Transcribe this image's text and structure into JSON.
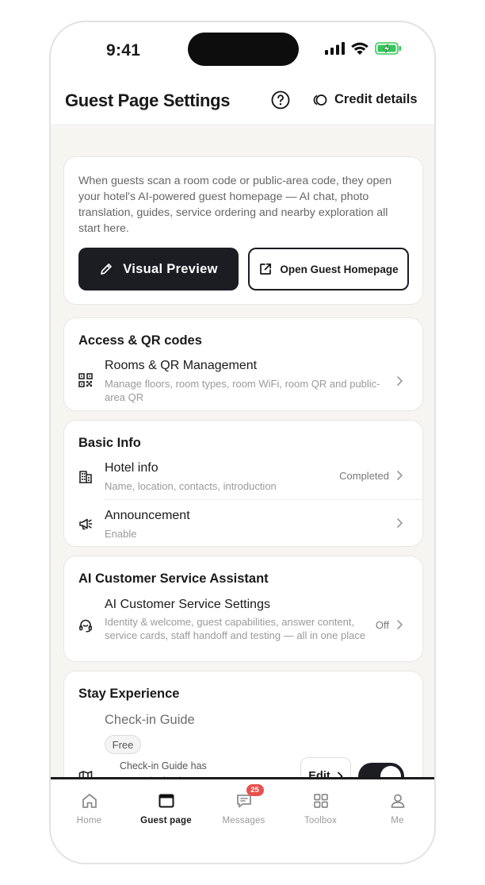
{
  "status_bar": {
    "time": "9:41"
  },
  "header": {
    "title": "Guest Page Settings",
    "help_icon": "help-circle-icon",
    "credit_label": "Credit details"
  },
  "intro": {
    "description": "When guests scan a room code or public-area code, they open your hotel's AI-powered guest homepage — AI chat, photo translation, guides, service ordering and nearby exploration all start here.",
    "preview_label": "Visual Preview",
    "open_label": "Open Guest Homepage"
  },
  "access": {
    "title": "Access & QR codes",
    "items": [
      {
        "title": "Rooms & QR Management",
        "subtitle": "Manage floors, room types, room WiFi, room QR and public-area QR",
        "icon": "qr-code-icon"
      }
    ]
  },
  "basic_info": {
    "title": "Basic Info",
    "items": [
      {
        "title": "Hotel info",
        "subtitle": "Name, location, contacts, introduction",
        "status": "Completed",
        "icon": "building-icon"
      },
      {
        "title": "Announcement",
        "subtitle": "Enable",
        "icon": "megaphone-icon"
      }
    ]
  },
  "ai_assistant": {
    "title": "AI Customer Service Assistant",
    "items": [
      {
        "title": "AI Customer Service Settings",
        "subtitle": "Identity & welcome, guest capabilities, answer content, service cards, staff handoff and testing — all in one place",
        "status": "Off",
        "icon": "headset-icon"
      }
    ]
  },
  "stay": {
    "title": "Stay Experience",
    "guide_title": "Check-in Guide",
    "badge": "Free",
    "guide_text": "Check-in Guide has no content yet. Please edit",
    "edit_label": "Edit",
    "toggle_on": true,
    "icon": "map-icon"
  },
  "tabs": [
    {
      "label": "Home",
      "icon": "home-icon",
      "active": false
    },
    {
      "label": "Guest page",
      "icon": "browser-window-icon",
      "active": true
    },
    {
      "label": "Messages",
      "icon": "message-icon",
      "active": false,
      "badge": "25"
    },
    {
      "label": "Toolbox",
      "icon": "grid-icon",
      "active": false
    },
    {
      "label": "Me",
      "icon": "user-icon",
      "active": false
    }
  ],
  "colors": {
    "primary_dark": "#1c1d22",
    "background": "#f6f5f2",
    "badge_red": "#e8504f",
    "battery_green": "#34c759"
  }
}
